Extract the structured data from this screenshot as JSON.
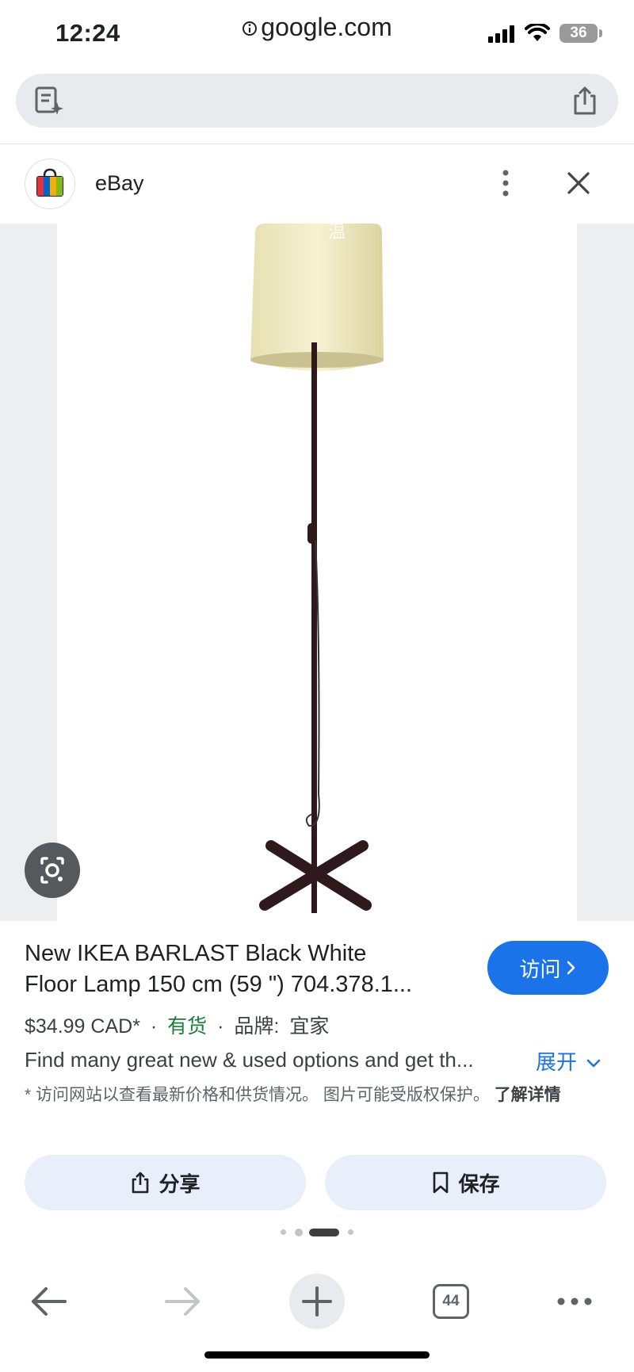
{
  "status_bar": {
    "time": "12:24",
    "battery": "36"
  },
  "browser": {
    "url": "google.com",
    "url_icon": "info-icon",
    "left_icon": "page-summary-icon",
    "right_icon": "share-icon"
  },
  "result": {
    "source_name": "eBay",
    "source_icon": "ebay-shopping-bag-icon",
    "more_icon": "more-vert-icon",
    "close_icon": "close-icon",
    "image_watermark": "温",
    "title_line1": "New IKEA BARLAST Black White",
    "title_line2": "Floor Lamp 150 cm (59 \") 704.378.1...",
    "visit_label": "访问",
    "price": "$34.99 CAD*",
    "separator": "·",
    "availability": "有货",
    "brand_label": "品牌:",
    "brand_value": "宜家",
    "description": "Find many great new & used options and get th...",
    "expand_label": "展开",
    "disclaimer": "* 访问网站以查看最新价格和供货情况。 图片可能受版权保护。",
    "learn_more": "了解详情"
  },
  "actions": {
    "share_label": "分享",
    "save_label": "保存"
  },
  "toolbar": {
    "tabs_count": "44"
  },
  "colors": {
    "accent": "#1a73e8",
    "in_stock": "#188038",
    "pill_bg": "#e8effb"
  }
}
